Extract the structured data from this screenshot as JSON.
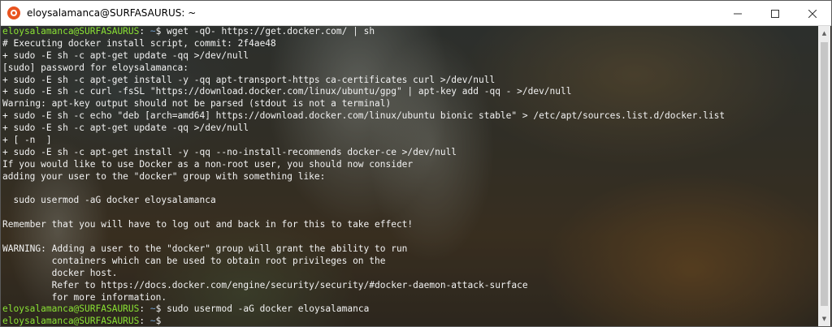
{
  "window": {
    "title": "eloysalamanca@SURFASAURUS: ~",
    "controls": {
      "minimize_icon": "minimize-icon",
      "maximize_icon": "maximize-icon",
      "close_icon": "close-icon"
    },
    "accent_color": "#e95420"
  },
  "terminal": {
    "prompt": {
      "user_host": "eloysalamanca@SURFASAURUS",
      "separator": ":",
      "path": " ~",
      "symbol": "$ "
    },
    "lines": [
      {
        "type": "prompt",
        "command": "wget -qO- https://get.docker.com/ | sh"
      },
      {
        "type": "output",
        "text": "# Executing docker install script, commit: 2f4ae48"
      },
      {
        "type": "output",
        "text": "+ sudo -E sh -c apt-get update -qq >/dev/null"
      },
      {
        "type": "output",
        "text": "[sudo] password for eloysalamanca:"
      },
      {
        "type": "output",
        "text": "+ sudo -E sh -c apt-get install -y -qq apt-transport-https ca-certificates curl >/dev/null"
      },
      {
        "type": "output",
        "text": "+ sudo -E sh -c curl -fsSL \"https://download.docker.com/linux/ubuntu/gpg\" | apt-key add -qq - >/dev/null"
      },
      {
        "type": "output",
        "text": "Warning: apt-key output should not be parsed (stdout is not a terminal)"
      },
      {
        "type": "output",
        "text": "+ sudo -E sh -c echo \"deb [arch=amd64] https://download.docker.com/linux/ubuntu bionic stable\" > /etc/apt/sources.list.d/docker.list"
      },
      {
        "type": "output",
        "text": "+ sudo -E sh -c apt-get update -qq >/dev/null"
      },
      {
        "type": "output",
        "text": "+ [ -n  ]"
      },
      {
        "type": "output",
        "text": "+ sudo -E sh -c apt-get install -y -qq --no-install-recommends docker-ce >/dev/null"
      },
      {
        "type": "output",
        "text": "If you would like to use Docker as a non-root user, you should now consider"
      },
      {
        "type": "output",
        "text": "adding your user to the \"docker\" group with something like:"
      },
      {
        "type": "output",
        "text": ""
      },
      {
        "type": "output",
        "text": "  sudo usermod -aG docker eloysalamanca"
      },
      {
        "type": "output",
        "text": ""
      },
      {
        "type": "output",
        "text": "Remember that you will have to log out and back in for this to take effect!"
      },
      {
        "type": "output",
        "text": ""
      },
      {
        "type": "output",
        "text": "WARNING: Adding a user to the \"docker\" group will grant the ability to run"
      },
      {
        "type": "output",
        "text": "         containers which can be used to obtain root privileges on the"
      },
      {
        "type": "output",
        "text": "         docker host."
      },
      {
        "type": "output",
        "text": "         Refer to https://docs.docker.com/engine/security/security/#docker-daemon-attack-surface"
      },
      {
        "type": "output",
        "text": "         for more information."
      },
      {
        "type": "prompt",
        "command": "sudo usermod -aG docker eloysalamanca"
      },
      {
        "type": "prompt",
        "command": ""
      }
    ],
    "colors": {
      "foreground": "#f2f2f2",
      "user_host": "#8ae234",
      "path": "#729fcf"
    }
  },
  "scrollbar": {
    "up_icon": "scroll-up-arrow-icon",
    "down_icon": "scroll-down-arrow-icon"
  }
}
